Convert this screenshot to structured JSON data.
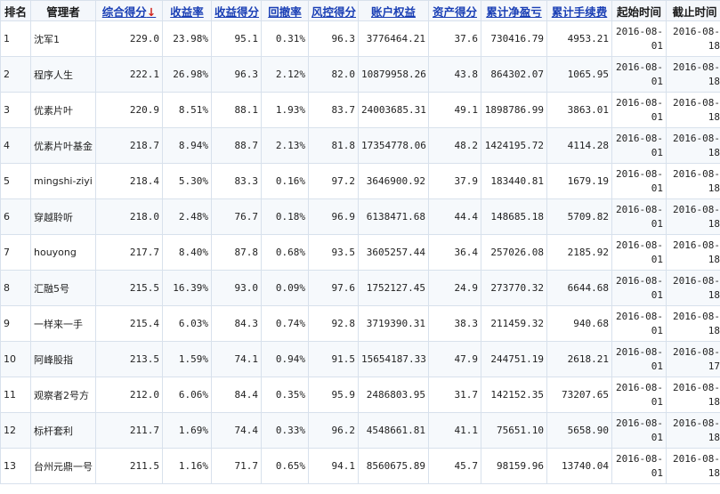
{
  "headers": {
    "rank": "排名",
    "manager": "管理者",
    "score": "综合得分",
    "sort_arrow": "↓",
    "return_rate": "收益率",
    "return_score": "收益得分",
    "drawdown": "回撤率",
    "risk_score": "风控得分",
    "equity": "账户权益",
    "asset_score": "资产得分",
    "pnl": "累计净盈亏",
    "fees": "累计手续费",
    "start": "起始时间",
    "end": "截止时间"
  },
  "rows": [
    {
      "rank": "1",
      "manager": "沈军1",
      "score": "229.0",
      "return_rate": "23.98%",
      "return_score": "95.1",
      "drawdown": "0.31%",
      "risk_score": "96.3",
      "equity": "3776464.21",
      "asset_score": "37.6",
      "pnl": "730416.79",
      "fees": "4953.21",
      "start_a": "2016-08-",
      "start_b": "01",
      "end_a": "2016-08-",
      "end_b": "18"
    },
    {
      "rank": "2",
      "manager": "程序人生",
      "score": "222.1",
      "return_rate": "26.98%",
      "return_score": "96.3",
      "drawdown": "2.12%",
      "risk_score": "82.0",
      "equity": "10879958.26",
      "asset_score": "43.8",
      "pnl": "864302.07",
      "fees": "1065.95",
      "start_a": "2016-08-",
      "start_b": "01",
      "end_a": "2016-08-",
      "end_b": "18"
    },
    {
      "rank": "3",
      "manager": "优素片叶",
      "score": "220.9",
      "return_rate": "8.51%",
      "return_score": "88.1",
      "drawdown": "1.93%",
      "risk_score": "83.7",
      "equity": "24003685.31",
      "asset_score": "49.1",
      "pnl": "1898786.99",
      "fees": "3863.01",
      "start_a": "2016-08-",
      "start_b": "01",
      "end_a": "2016-08-",
      "end_b": "18"
    },
    {
      "rank": "4",
      "manager": "优素片叶基金",
      "score": "218.7",
      "return_rate": "8.94%",
      "return_score": "88.7",
      "drawdown": "2.13%",
      "risk_score": "81.8",
      "equity": "17354778.06",
      "asset_score": "48.2",
      "pnl": "1424195.72",
      "fees": "4114.28",
      "start_a": "2016-08-",
      "start_b": "01",
      "end_a": "2016-08-",
      "end_b": "18"
    },
    {
      "rank": "5",
      "manager": "mingshi-ziyi",
      "score": "218.4",
      "return_rate": "5.30%",
      "return_score": "83.3",
      "drawdown": "0.16%",
      "risk_score": "97.2",
      "equity": "3646900.92",
      "asset_score": "37.9",
      "pnl": "183440.81",
      "fees": "1679.19",
      "start_a": "2016-08-",
      "start_b": "01",
      "end_a": "2016-08-",
      "end_b": "18"
    },
    {
      "rank": "6",
      "manager": "穿越聆听",
      "score": "218.0",
      "return_rate": "2.48%",
      "return_score": "76.7",
      "drawdown": "0.18%",
      "risk_score": "96.9",
      "equity": "6138471.68",
      "asset_score": "44.4",
      "pnl": "148685.18",
      "fees": "5709.82",
      "start_a": "2016-08-",
      "start_b": "01",
      "end_a": "2016-08-",
      "end_b": "18"
    },
    {
      "rank": "7",
      "manager": "houyong",
      "score": "217.7",
      "return_rate": "8.40%",
      "return_score": "87.8",
      "drawdown": "0.68%",
      "risk_score": "93.5",
      "equity": "3605257.44",
      "asset_score": "36.4",
      "pnl": "257026.08",
      "fees": "2185.92",
      "start_a": "2016-08-",
      "start_b": "01",
      "end_a": "2016-08-",
      "end_b": "18"
    },
    {
      "rank": "8",
      "manager": "汇融5号",
      "score": "215.5",
      "return_rate": "16.39%",
      "return_score": "93.0",
      "drawdown": "0.09%",
      "risk_score": "97.6",
      "equity": "1752127.45",
      "asset_score": "24.9",
      "pnl": "273770.32",
      "fees": "6644.68",
      "start_a": "2016-08-",
      "start_b": "01",
      "end_a": "2016-08-",
      "end_b": "18"
    },
    {
      "rank": "9",
      "manager": "一样来一手",
      "score": "215.4",
      "return_rate": "6.03%",
      "return_score": "84.3",
      "drawdown": "0.74%",
      "risk_score": "92.8",
      "equity": "3719390.31",
      "asset_score": "38.3",
      "pnl": "211459.32",
      "fees": "940.68",
      "start_a": "2016-08-",
      "start_b": "01",
      "end_a": "2016-08-",
      "end_b": "18"
    },
    {
      "rank": "10",
      "manager": "阿峰股指",
      "score": "213.5",
      "return_rate": "1.59%",
      "return_score": "74.1",
      "drawdown": "0.94%",
      "risk_score": "91.5",
      "equity": "15654187.33",
      "asset_score": "47.9",
      "pnl": "244751.19",
      "fees": "2618.21",
      "start_a": "2016-08-",
      "start_b": "01",
      "end_a": "2016-08-",
      "end_b": "17"
    },
    {
      "rank": "11",
      "manager": "观察者2号方",
      "score": "212.0",
      "return_rate": "6.06%",
      "return_score": "84.4",
      "drawdown": "0.35%",
      "risk_score": "95.9",
      "equity": "2486803.95",
      "asset_score": "31.7",
      "pnl": "142152.35",
      "fees": "73207.65",
      "start_a": "2016-08-",
      "start_b": "01",
      "end_a": "2016-08-",
      "end_b": "18"
    },
    {
      "rank": "12",
      "manager": "标杆套利",
      "score": "211.7",
      "return_rate": "1.69%",
      "return_score": "74.4",
      "drawdown": "0.33%",
      "risk_score": "96.2",
      "equity": "4548661.81",
      "asset_score": "41.1",
      "pnl": "75651.10",
      "fees": "5658.90",
      "start_a": "2016-08-",
      "start_b": "01",
      "end_a": "2016-08-",
      "end_b": "18"
    },
    {
      "rank": "13",
      "manager": "台州元鼎一号",
      "score": "211.5",
      "return_rate": "1.16%",
      "return_score": "71.7",
      "drawdown": "0.65%",
      "risk_score": "94.1",
      "equity": "8560675.89",
      "asset_score": "45.7",
      "pnl": "98159.96",
      "fees": "13740.04",
      "start_a": "2016-08-",
      "start_b": "01",
      "end_a": "2016-08-",
      "end_b": "18"
    }
  ],
  "colors": {
    "link": "#1a3fb5",
    "pnl": "#c0271f",
    "arrow": "#d0201a",
    "border": "#d8e1ec"
  }
}
